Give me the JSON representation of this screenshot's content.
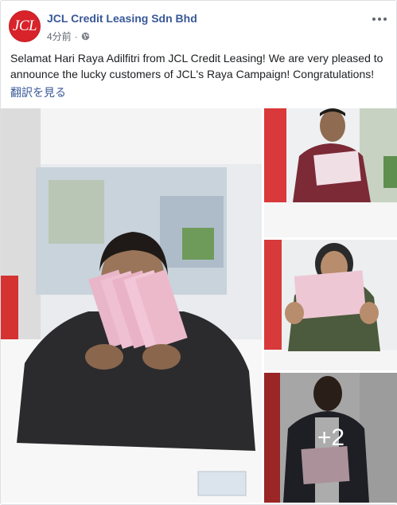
{
  "post": {
    "page_name": "JCL Credit Leasing Sdn Bhd",
    "avatar_text": "JCL",
    "timestamp": "4分前",
    "separator": "·",
    "text": "Selamat Hari Raya Adilfitri from JCL Credit Leasing! We are very pleased to announce the lucky customers of JCL's Raya Campaign! Congratulations!",
    "translate_label": "翻訳を見る",
    "more_photos_label": "+2"
  },
  "colors": {
    "brand_red": "#d8232a",
    "link_blue": "#385898",
    "meta_gray": "#616770"
  },
  "icons": {
    "privacy": "globe-icon",
    "options": "more-options-icon"
  }
}
